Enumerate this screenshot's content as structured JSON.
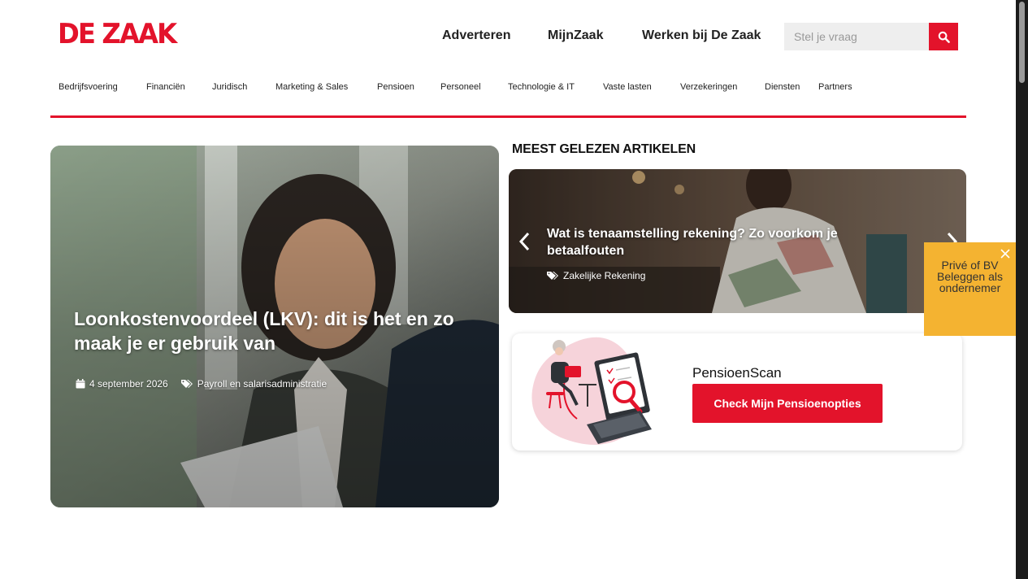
{
  "brand": {
    "logo_text": "DE ZAAK",
    "accent_color": "#e3132b"
  },
  "topnav": [
    "Adverteren",
    "MijnZaak",
    "Werken bij De Zaak"
  ],
  "search": {
    "placeholder": "Stel je vraag",
    "icon": "search-icon"
  },
  "categories": [
    "Bedrijfsvoering",
    "Financiën",
    "Juridisch",
    "Marketing & Sales",
    "Pensioen",
    "Personeel",
    "Technologie & IT",
    "Vaste lasten",
    "Verzekeringen",
    "Diensten",
    "Partners"
  ],
  "hero": {
    "title": "Loonkostenvoordeel (LKV): dit is het en zo maak je er gebruik van",
    "date": "4 september 2026",
    "category": "Payroll en salarisadministratie"
  },
  "most_read": {
    "heading": "MEEST GELEZEN ARTIKELEN",
    "title": "Wat is tenaamstelling rekening? Zo voorkom je betaalfouten",
    "tag": "Zakelijke Rekening"
  },
  "pension": {
    "title": "PensioenScan",
    "button": "Check Mijn Pensioenopties"
  },
  "promo": {
    "text": "Privé of BV Beleggen als ondernemer",
    "color": "#f4b331"
  }
}
